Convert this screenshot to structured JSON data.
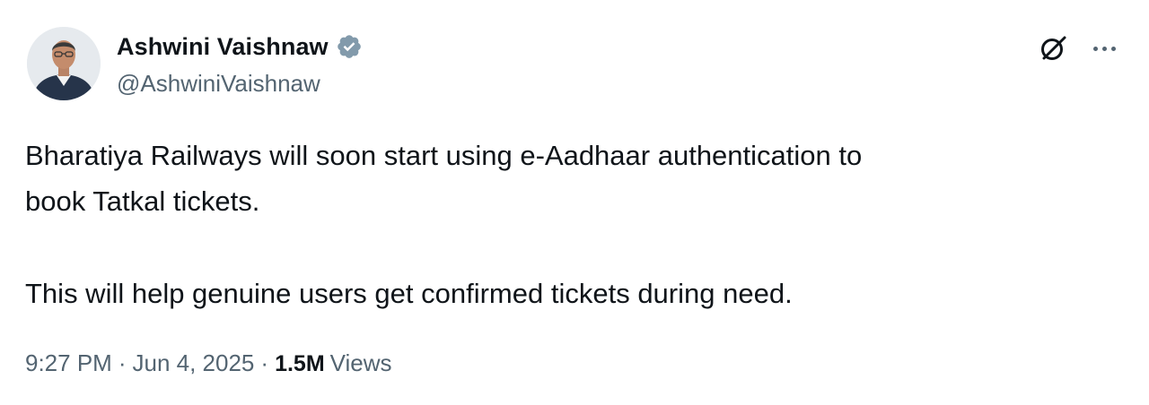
{
  "author": {
    "display_name": "Ashwini Vaishnaw",
    "handle": "@AshwiniVaishnaw",
    "verified_icon": "verified-badge-icon",
    "verified_color": "#829aab"
  },
  "actions": {
    "grok_icon": "grok-icon",
    "more_icon": "more-horizontal-icon"
  },
  "tweet": {
    "line1": "Bharatiya Railways will soon start using e-Aadhaar authentication to",
    "line2": "book Tatkal tickets.",
    "line3": "This will help genuine users get confirmed tickets during need."
  },
  "meta": {
    "time": "9:27 PM",
    "separator": "·",
    "date": "Jun 4, 2025",
    "views_count": "1.5M",
    "views_label": "Views"
  },
  "colors": {
    "text_primary": "#0f1419",
    "text_secondary": "#536471",
    "background": "#ffffff"
  }
}
